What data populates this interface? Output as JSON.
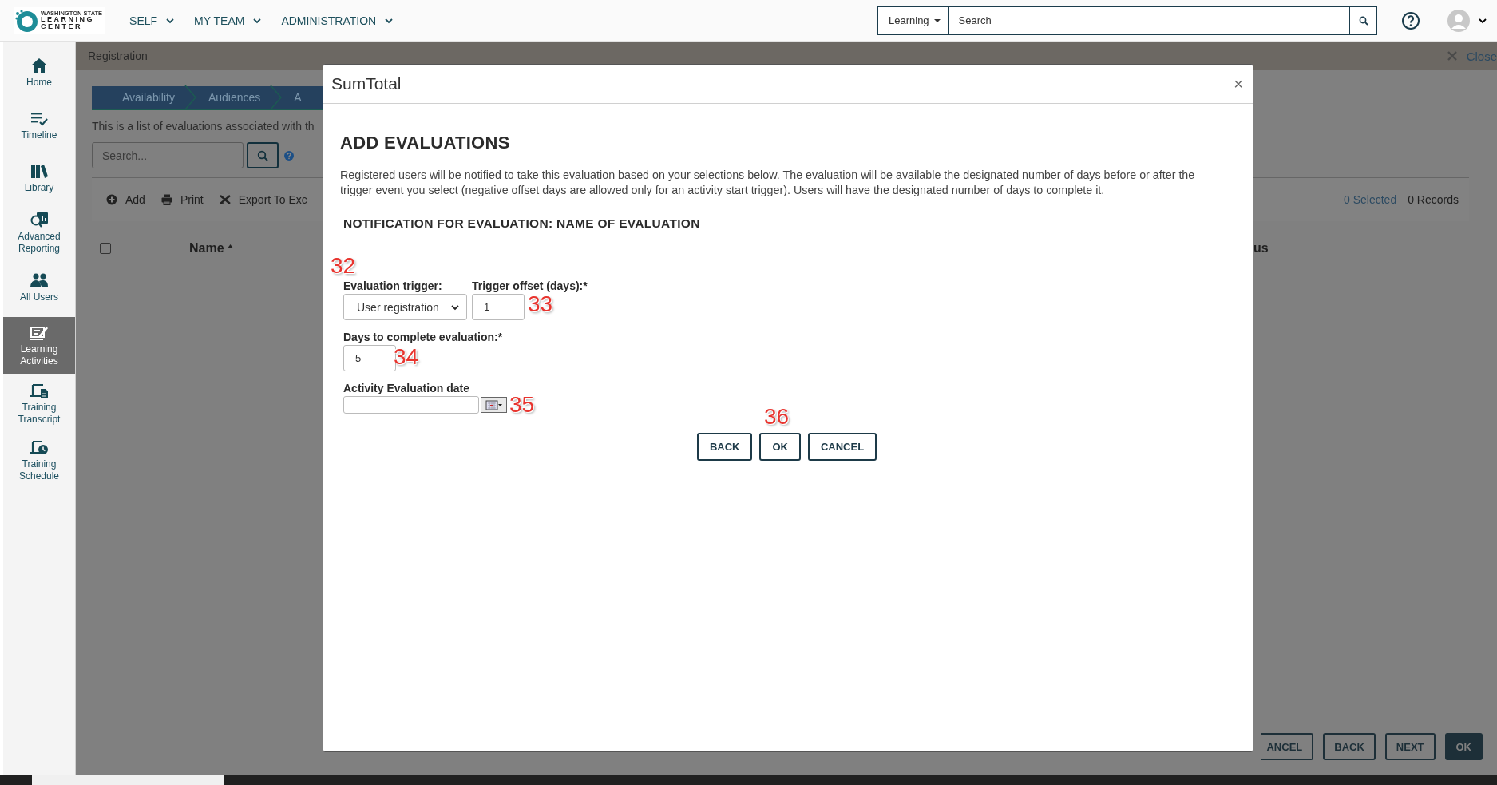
{
  "header": {
    "logo": {
      "lines": [
        "WASHINGTON STATE",
        "LEARNING",
        "CENTER"
      ]
    },
    "nav": [
      {
        "label": "SELF"
      },
      {
        "label": "MY TEAM"
      },
      {
        "label": "ADMINISTRATION"
      }
    ],
    "search": {
      "scope": "Learning",
      "placeholder": "Search"
    }
  },
  "sidebar": {
    "items": [
      {
        "label": "Home",
        "selected": false
      },
      {
        "label": "Timeline",
        "selected": false
      },
      {
        "label": "Library",
        "selected": false
      },
      {
        "label": "Advanced Reporting",
        "selected": false
      },
      {
        "label": "All Users",
        "selected": false
      },
      {
        "label": "Learning Activities",
        "selected": true
      },
      {
        "label": "Training Transcript",
        "selected": false
      },
      {
        "label": "Training Schedule",
        "selected": false
      }
    ]
  },
  "page": {
    "title": "Registration",
    "close": "Close",
    "steps": [
      {
        "label": "Availability"
      },
      {
        "label": "Audiences"
      },
      {
        "label": "A"
      }
    ],
    "description": "This is a list of evaluations associated with th",
    "search": {
      "placeholder": "Search..."
    },
    "toolbar": [
      {
        "label": "Add"
      },
      {
        "label": "Print"
      },
      {
        "label": "Export To Exc"
      }
    ],
    "selected_count": "0 Selected",
    "records": "0 Records",
    "select_all": {
      "checked": false
    },
    "columns": [
      {
        "label": "Name"
      },
      {
        "label": "us"
      }
    ],
    "footer_buttons": [
      {
        "label": "ANCEL",
        "kind": "outline",
        "clipped": true
      },
      {
        "label": "BACK",
        "kind": "outline",
        "clipped": false
      },
      {
        "label": "NEXT",
        "kind": "outline",
        "clipped": false
      },
      {
        "label": "OK",
        "kind": "primary",
        "clipped": false
      }
    ]
  },
  "dialog": {
    "title": "SumTotal",
    "close": "×",
    "heading": "ADD EVALUATIONS",
    "description": "Registered users will be notified to take this evaluation based on your selections below. The evaluation will be available the designated number of days before or after the trigger event you select (negative offset days are allowed only for an activity start trigger). Users will have the designated number of days to complete it.",
    "subheading": "NOTIFICATION FOR EVALUATION: NAME OF EVALUATION",
    "rows": [
      [
        {
          "kind": "select",
          "label": "Evaluation trigger:",
          "value": "User registration"
        },
        {
          "kind": "number",
          "label": "Trigger offset (days):*",
          "value": "1"
        }
      ],
      [
        {
          "kind": "number",
          "label": "Days to complete evaluation:*",
          "value": "5"
        }
      ],
      [
        {
          "kind": "date",
          "label": "Activity Evaluation date"
        }
      ]
    ],
    "buttons": [
      {
        "label": "BACK"
      },
      {
        "label": "OK"
      },
      {
        "label": "CANCEL"
      }
    ],
    "callouts": [
      {
        "label": "32"
      },
      {
        "label": "33"
      },
      {
        "label": "34"
      },
      {
        "label": "35"
      },
      {
        "label": "36"
      }
    ]
  }
}
